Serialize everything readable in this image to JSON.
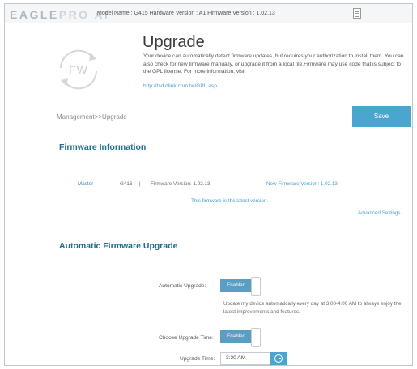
{
  "header": {
    "brand_a": "EAGLE",
    "brand_b": "PRO AI",
    "model_info": "Model Name : G415 Hardware Version : A1 Firmware Version : 1.02.13"
  },
  "page": {
    "fw_badge": "FW",
    "title": "Upgrade",
    "intro": "Your device can automatically detect firmware updates, but requires your authorization to install them. You can also check for new firmware manually, or upgrade it from a local file.Firmware may use code that is subject to the GPL license. For more information, visit",
    "intro_link": "http://tsd.dlink.com.tw/GPL.asp.",
    "breadcrumb": "Management>>Upgrade",
    "save_label": "Save"
  },
  "firmware_info": {
    "section_title": "Firmware Information",
    "master_label": "Master",
    "model": "G416",
    "separator": "|",
    "firmware_version": "Firmware Version: 1.02.13",
    "new_firmware_version": "New Firmware Version: 1.02.13",
    "latest_message": "This firmware is the latest version.",
    "advanced_link": "Advanced Settings..."
  },
  "auto_upgrade": {
    "section_title": "Automatic Firmware Upgrade",
    "auto_label": "Automatic Upgrade:",
    "auto_state": "Enabled",
    "description": "Update my device automatically every day at 3:00-4:00 AM to always enjoy the latest improvements and features.",
    "choose_label": "Choose Upgrade Time:",
    "choose_state": "Enabled",
    "time_label": "Upgrade Time:",
    "time_value": "3:30 AM"
  },
  "colors": {
    "accent": "#4ba6cf",
    "section_title": "#1f6e8c",
    "link": "#4a9ec8"
  }
}
